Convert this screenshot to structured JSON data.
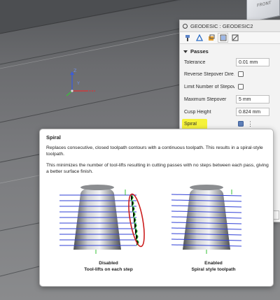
{
  "viewcube": {
    "label": "FRONT"
  },
  "viewport": {
    "axis_z": "Z",
    "axis_y": "Y"
  },
  "panel": {
    "title": "GEODESIC : GEODESIC2",
    "tabs": [
      "tool-icon",
      "geometry-icon",
      "heights-icon",
      "passes-icon",
      "linking-icon"
    ],
    "section": "Passes",
    "rows": [
      {
        "label": "Tolerance",
        "value": "0.01 mm",
        "kind": "field"
      },
      {
        "label": "Reverse Stepover Dire…",
        "kind": "check",
        "checked": false
      },
      {
        "label": "Limit Number of Stepov…",
        "kind": "check",
        "checked": false
      },
      {
        "label": "Maximum Stepover",
        "value": "5 mm",
        "kind": "field"
      },
      {
        "label": "Cusp Height",
        "value": "0.824 mm",
        "kind": "field"
      },
      {
        "label": "Spiral",
        "kind": "check",
        "checked": true
      }
    ]
  },
  "tooltip": {
    "title": "Spiral",
    "p1": "Replaces consecutive, closed toolpath contours with a continuous toolpath. This results in a spiral-style toolpath.",
    "p2": "This minimizes the number of tool-lifts resulting in cutting passes with no steps between each pass, giving a better surface finish.",
    "left_caption_1": "Disabled",
    "left_caption_2": "Tool-lifts on each step",
    "right_caption_1": "Enabled",
    "right_caption_2": "Spiral style toolpath"
  },
  "colors": {
    "highlight": "#f5f23b",
    "toolpath": "#2f3fd6",
    "lift_marker": "#35c235",
    "callout": "#cc1f1f"
  }
}
